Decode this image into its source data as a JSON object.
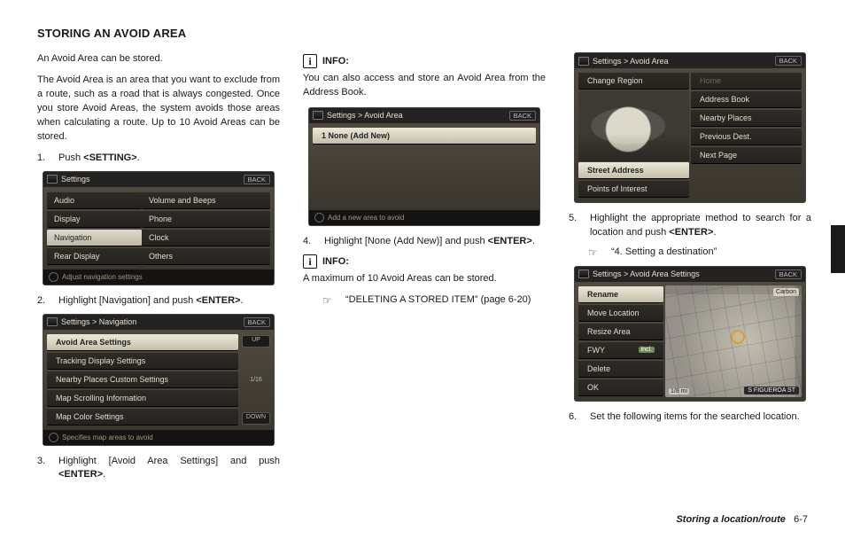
{
  "heading": "STORING AN AVOID AREA",
  "intro1": "An Avoid Area can be stored.",
  "intro2": "The Avoid Area is an area that you want to exclude from a route, such as a road that is always congested. Once you store Avoid Areas, the system avoids those areas when calculating a route. Up to 10 Avoid Areas can be stored.",
  "steps": {
    "s1": {
      "n": "1.",
      "pre": "Push ",
      "kw": "<SETTING>",
      "post": "."
    },
    "s2": {
      "n": "2.",
      "pre": "Highlight [Navigation] and push ",
      "kw": "<ENTER>",
      "post": "."
    },
    "s3": {
      "n": "3.",
      "pre": "Highlight [Avoid Area Settings] and push ",
      "kw": "<ENTER>",
      "post": "."
    },
    "s4": {
      "n": "4.",
      "pre": "Highlight [None (Add New)] and push ",
      "kw": "<ENTER>",
      "post": "."
    },
    "s5": {
      "n": "5.",
      "pre": "Highlight the appropriate method to search for a location and push ",
      "kw": "<ENTER>",
      "post": "."
    },
    "s6": {
      "n": "6.",
      "txt": "Set the following items for the searched location."
    }
  },
  "info": {
    "label": "INFO:",
    "body1": "You can also access and store an Avoid Area from the Address Book.",
    "body2": "A maximum of 10 Avoid Areas can be stored."
  },
  "xref": {
    "a": "“DELETING A STORED ITEM” (page 6-20)",
    "b": "“4. Setting a destination”"
  },
  "shot_common": {
    "back": "BACK"
  },
  "shot1": {
    "title": "Settings",
    "rows": [
      [
        "Audio",
        "Volume and Beeps"
      ],
      [
        "Display",
        "Phone"
      ],
      [
        "Navigation",
        "Clock"
      ],
      [
        "Rear Display",
        "Others"
      ]
    ],
    "hl_row": 2,
    "hl_col": 0,
    "foot": "Adjust navigation settings"
  },
  "shot2": {
    "title": "Settings > Navigation",
    "items": [
      "Avoid Area Settings",
      "Tracking Display Settings",
      "Nearby Places Custom Settings",
      "Map Scrolling Information",
      "Map Color Settings"
    ],
    "hl": 0,
    "side": {
      "up": "UP",
      "page": "1/16",
      "down": "DOWN"
    },
    "foot": "Specifies map areas to avoid"
  },
  "shot3": {
    "title": "Settings > Avoid Area",
    "items": [
      "1   None (Add New)"
    ],
    "hl": 0,
    "foot": "Add a new area to avoid"
  },
  "shot4": {
    "title": "Settings > Avoid Area",
    "left": [
      "Change Region",
      "",
      "Street Address",
      "Points of Interest"
    ],
    "right": [
      "Home",
      "Address Book",
      "Nearby Places",
      "Previous Dest.",
      "Next Page"
    ],
    "left_hl": 2
  },
  "shot5": {
    "title": "Settings > Avoid Area Settings",
    "items": [
      "Rename",
      "Move Location",
      "Resize Area",
      "FWY",
      "Delete",
      "OK"
    ],
    "fwy_badge": "incl.",
    "map": {
      "scale": "1/8 mi",
      "street": "S FIGUEROA ST",
      "badge": "Carbon"
    }
  },
  "footer": {
    "section": "Storing a location/route",
    "page": "6-7"
  }
}
